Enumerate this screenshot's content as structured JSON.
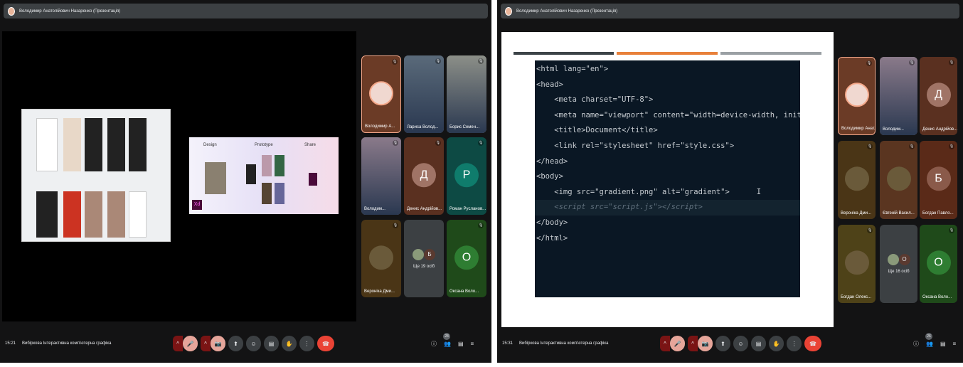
{
  "left": {
    "title": "Володимир Анатолійович Назаренко (Презентація)",
    "time": "15:21",
    "meeting": "Вибіркова Інтерактивна комп'ютерна графіка",
    "people_count": "28",
    "slide": {
      "labels": [
        "Design",
        "Prototype",
        "Share"
      ],
      "logo": "Xd"
    },
    "tiles": [
      {
        "name": "Володимир А...",
        "bg": "#6b3b26",
        "type": "avatar",
        "sel": true
      },
      {
        "name": "Лариса Волод...",
        "bg": "#5a6a7a",
        "type": "video"
      },
      {
        "name": "Борис Семен...",
        "bg": "#8c8f88",
        "type": "video"
      },
      {
        "name": "Володим...",
        "bg": "#8a7a8a",
        "type": "video"
      },
      {
        "name": "Денис Андрійов...",
        "bg": "#5a3020",
        "type": "letter",
        "letter": "Д",
        "cbg": "#a07466"
      },
      {
        "name": "Роман Русланов...",
        "bg": "#0d4a44",
        "type": "letter",
        "letter": "Р",
        "cbg": "#0f7c6c"
      },
      {
        "name": "Вероніка Дми...",
        "bg": "#4a3516",
        "type": "avatar2"
      },
      {
        "name": "Ще 19 осіб",
        "bg": "#3c4043",
        "type": "more",
        "letter": "Б"
      },
      {
        "name": "Оксана Воло...",
        "bg": "#1f4a1a",
        "type": "letter",
        "letter": "О",
        "cbg": "#2e7d32"
      }
    ]
  },
  "right": {
    "title": "Володимир Анатолійович Назаренко (Презентація)",
    "time": "15:31",
    "meeting": "Вибіркова Інтерактивна комп'ютерна графіка",
    "people_count": "26",
    "code": [
      "<html lang=\"en\">",
      "<head>",
      "    <meta charset=\"UTF-8\">",
      "    <meta name=\"viewport\" content=\"width=device-width, initial-scal",
      "    <title>Document</title>",
      "    <link rel=\"stylesheet\" href=\"style.css\">",
      "</head>",
      "<body>",
      "    <img src=\"gradient.png\" alt=\"gradient\">      I",
      "    <script src=\"script.js\"></script>",
      "</body>",
      "</html>"
    ],
    "tiles": [
      {
        "name": "Володимир Анат...",
        "bg": "#6b3b26",
        "type": "avatar",
        "sel": true
      },
      {
        "name": "Володим...",
        "bg": "#8a7a8a",
        "type": "video"
      },
      {
        "name": "Денис Андрійов...",
        "bg": "#5a3020",
        "type": "letter",
        "letter": "Д",
        "cbg": "#a07466"
      },
      {
        "name": "Вероніка Дми...",
        "bg": "#4a3516",
        "type": "avatar2"
      },
      {
        "name": "Євгеній Васил...",
        "bg": "#5a3520",
        "type": "avatar2"
      },
      {
        "name": "Богдан Павло...",
        "bg": "#5a2a18",
        "type": "letter",
        "letter": "Б",
        "cbg": "#8a5a4a"
      },
      {
        "name": "Богдан Олекс...",
        "bg": "#4e4218",
        "type": "avatar2"
      },
      {
        "name": "Ще 16 осіб",
        "bg": "#3c4043",
        "type": "more",
        "letter": "О"
      },
      {
        "name": "Оксана Воло...",
        "bg": "#1f4a1a",
        "type": "letter",
        "letter": "О",
        "cbg": "#2e7d32"
      }
    ]
  },
  "controls": {
    "caret": "^",
    "mic": "🎤",
    "cam": "📷",
    "present": "⬆",
    "emoji": "☺",
    "captions": "▤",
    "hand": "✋",
    "more": "⋮",
    "hangup": "☎",
    "info": "ⓘ",
    "people": "👥",
    "chat": "▤",
    "activities": "≡",
    "warn": "!"
  }
}
